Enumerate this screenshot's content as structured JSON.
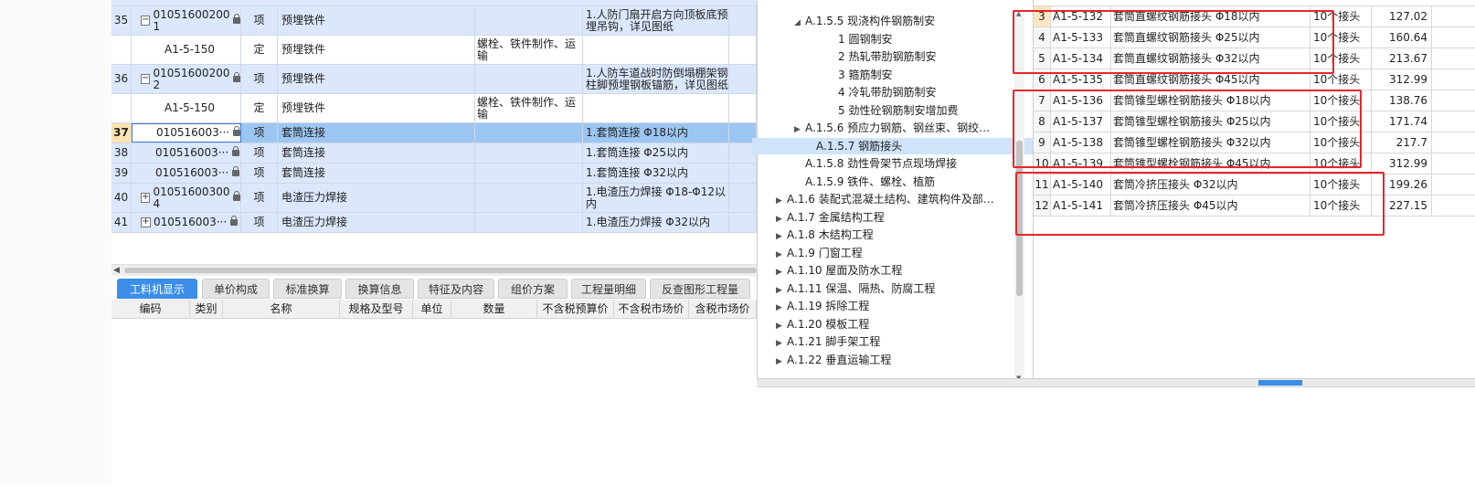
{
  "main_rows": [
    {
      "num": "35",
      "code_l1": "01051600200",
      "code_l2": "1",
      "expander": "minus",
      "type": "项",
      "name": "预埋铁件",
      "spec": "",
      "feature": "1.人防门扇开启方向顶板底预埋吊钩，详见图纸",
      "style": "blue"
    },
    {
      "num": "",
      "code_l1": "A1-5-150",
      "code_l2": "",
      "expander": "",
      "type": "定",
      "name": "预埋铁件",
      "spec": "螺栓、铁件制作、运输",
      "feature": "",
      "style": "white"
    },
    {
      "num": "36",
      "code_l1": "01051600200",
      "code_l2": "2",
      "expander": "minus",
      "type": "项",
      "name": "预埋铁件",
      "spec": "",
      "feature": "1.人防车道战时防倒塌棚架钢柱脚预埋钢板锚筋，详见图纸",
      "style": "blue"
    },
    {
      "num": "",
      "code_l1": "A1-5-150",
      "code_l2": "",
      "expander": "",
      "type": "定",
      "name": "预埋铁件",
      "spec": "螺栓、铁件制作、运输",
      "feature": "",
      "style": "white"
    },
    {
      "num": "37",
      "code_l1": "010516003···",
      "code_l2": "",
      "expander": "",
      "type": "项",
      "name": "套筒连接",
      "spec": "",
      "feature": "1.套筒连接  Φ18以内",
      "style": "sel"
    },
    {
      "num": "38",
      "code_l1": "010516003···",
      "code_l2": "",
      "expander": "",
      "type": "项",
      "name": "套筒连接",
      "spec": "",
      "feature": "1.套筒连接  Φ25以内",
      "style": "blue"
    },
    {
      "num": "39",
      "code_l1": "010516003···",
      "code_l2": "",
      "expander": "",
      "type": "项",
      "name": "套筒连接",
      "spec": "",
      "feature": "1.套筒连接  Φ32以内",
      "style": "blue"
    },
    {
      "num": "40",
      "code_l1": "01051600300",
      "code_l2": "4",
      "expander": "plus",
      "type": "项",
      "name": "电渣压力焊接",
      "spec": "",
      "feature": "1.电渣压力焊接 Φ18-Φ12以内",
      "style": "blue"
    },
    {
      "num": "41",
      "code_l1": "010516003···",
      "code_l2": "",
      "expander": "plus",
      "type": "项",
      "name": "电渣压力焊接",
      "spec": "",
      "feature": "1.电渣压力焊接 Φ32以内",
      "style": "blue"
    }
  ],
  "tabs": [
    "工料机显示",
    "单价构成",
    "标准换算",
    "换算信息",
    "特征及内容",
    "组价方案",
    "工程量明细",
    "反查图形工程量"
  ],
  "sub_headers": [
    "编码",
    "类别",
    "名称",
    "规格及型号",
    "单位",
    "数量",
    "不含税预算价",
    "不含税市场价",
    "含税市场价"
  ],
  "tree": [
    {
      "label": "A.1.5.5 现浇构件钢筋制安",
      "arrow": "◢",
      "level": 2
    },
    {
      "label": "1 圆钢制安",
      "arrow": "",
      "level": 3
    },
    {
      "label": "2 热轧带肋钢筋制安",
      "arrow": "",
      "level": 3
    },
    {
      "label": "3 箍筋制安",
      "arrow": "",
      "level": 3
    },
    {
      "label": "4 冷轧带肋钢筋制安",
      "arrow": "",
      "level": 3
    },
    {
      "label": "5 劲性砼钢筋制安增加费",
      "arrow": "",
      "level": 3
    },
    {
      "label": "A.1.5.6 预应力钢筋、钢丝束、钢绞…",
      "arrow": "▶",
      "level": 2
    },
    {
      "label": "A.1.5.7 钢筋接头",
      "arrow": "",
      "level": 2
    },
    {
      "label": "A.1.5.8 劲性骨架节点现场焊接",
      "arrow": "",
      "level": 2
    },
    {
      "label": "A.1.5.9 铁件、螺栓、植筋",
      "arrow": "",
      "level": 2
    },
    {
      "label": "A.1.6 装配式混凝土结构、建筑构件及部…",
      "arrow": "▶",
      "level": 1
    },
    {
      "label": "A.1.7 金属结构工程",
      "arrow": "▶",
      "level": 1
    },
    {
      "label": "A.1.8 木结构工程",
      "arrow": "▶",
      "level": 1
    },
    {
      "label": "A.1.9 门窗工程",
      "arrow": "▶",
      "level": 1
    },
    {
      "label": "A.1.10 屋面及防水工程",
      "arrow": "▶",
      "level": 1
    },
    {
      "label": "A.1.11 保温、隔热、防腐工程",
      "arrow": "▶",
      "level": 1
    },
    {
      "label": "A.1.19 拆除工程",
      "arrow": "▶",
      "level": 1
    },
    {
      "label": "A.1.20 模板工程",
      "arrow": "▶",
      "level": 1
    },
    {
      "label": "A.1.21 脚手架工程",
      "arrow": "▶",
      "level": 1
    },
    {
      "label": "A.1.22 垂直运输工程",
      "arrow": "▶",
      "level": 1
    }
  ],
  "tree_selected_index": 7,
  "quota_rows": [
    {
      "n": "3",
      "code": "A1-5-132",
      "name": "套筒直螺纹钢筋接头 Φ18以内",
      "unit": "10个接头",
      "price": "127.02",
      "hl": true
    },
    {
      "n": "4",
      "code": "A1-5-133",
      "name": "套筒直螺纹钢筋接头 Φ25以内",
      "unit": "10个接头",
      "price": "160.64",
      "hl": false
    },
    {
      "n": "5",
      "code": "A1-5-134",
      "name": "套筒直螺纹钢筋接头 Φ32以内",
      "unit": "10个接头",
      "price": "213.67",
      "hl": false
    },
    {
      "n": "6",
      "code": "A1-5-135",
      "name": "套筒直螺纹钢筋接头 Φ45以内",
      "unit": "10个接头",
      "price": "312.99",
      "hl": false
    },
    {
      "n": "7",
      "code": "A1-5-136",
      "name": "套筒锥型螺栓钢筋接头 Φ18以内",
      "unit": "10个接头",
      "price": "138.76",
      "hl": false
    },
    {
      "n": "8",
      "code": "A1-5-137",
      "name": "套筒锥型螺栓钢筋接头 Φ25以内",
      "unit": "10个接头",
      "price": "171.74",
      "hl": false
    },
    {
      "n": "9",
      "code": "A1-5-138",
      "name": "套筒锥型螺栓钢筋接头 Φ32以内",
      "unit": "10个接头",
      "price": "217.7",
      "hl": false
    },
    {
      "n": "10",
      "code": "A1-5-139",
      "name": "套筒锥型螺栓钢筋接头 Φ45以内",
      "unit": "10个接头",
      "price": "312.99",
      "hl": false
    },
    {
      "n": "11",
      "code": "A1-5-140",
      "name": "套筒冷挤压接头 Φ32以内",
      "unit": "10个接头",
      "price": "199.26",
      "hl": false
    },
    {
      "n": "12",
      "code": "A1-5-141",
      "name": "套筒冷挤压接头 Φ45以内",
      "unit": "10个接头",
      "price": "227.15",
      "hl": false
    }
  ],
  "colors": {
    "accent": "#3b8ee9",
    "highlight_box": "#e8262a",
    "row_blue": "#dbe7fb",
    "row_selected": "#9cc6f2"
  }
}
